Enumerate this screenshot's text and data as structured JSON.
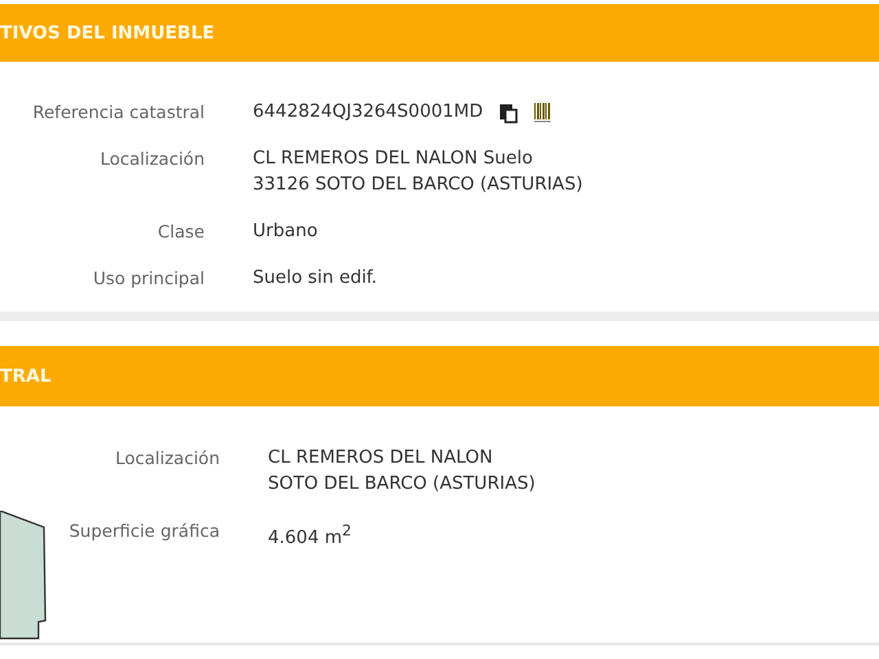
{
  "sections": [
    {
      "title": "TIVOS DEL INMUEBLE",
      "kind": "fields",
      "fields": [
        {
          "label": "Referencia catastral",
          "lines": [
            "6442824QJ3264S0001MD"
          ],
          "kind": "reference"
        },
        {
          "label": "Localización",
          "lines": [
            "CL REMEROS DEL NALON Suelo",
            "33126 SOTO DEL BARCO (ASTURIAS)"
          ],
          "kind": "text"
        },
        {
          "label": "Clase",
          "lines": [
            "Urbano"
          ],
          "kind": "text"
        },
        {
          "label": "Uso principal",
          "lines": [
            "Suelo sin edif."
          ],
          "kind": "text"
        }
      ]
    },
    {
      "title": "TRAL",
      "kind": "map",
      "fields": [
        {
          "label": "Localización",
          "lines": [
            "CL REMEROS DEL NALON",
            "SOTO DEL BARCO (ASTURIAS)"
          ],
          "kind": "text"
        },
        {
          "label": "Superficie gráfica",
          "lines": [
            "4.604 m$^{2}$"
          ],
          "kind": "text"
        }
      ]
    }
  ]
}
